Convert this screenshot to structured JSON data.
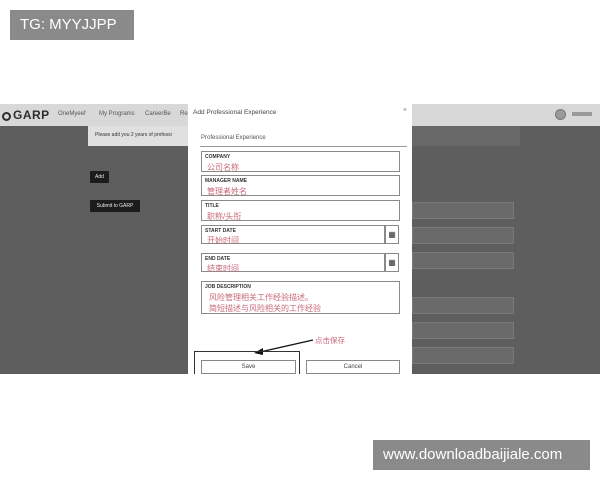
{
  "tag": "TG: MYYJJPP",
  "watermark": "www.downloadbaijiale.com",
  "colors": {
    "annotation": "#c9697a",
    "overlay": "#5e5e5e",
    "tag_bg": "#8a8a8a"
  },
  "app": {
    "logo": "GARP",
    "nav": [
      "OneMyeef",
      "My Programs",
      "CareerBe",
      "Re"
    ],
    "info_text": "Please add you 2 years of professi",
    "add_button": "Add",
    "submit_button": "Submit to GARP"
  },
  "modal": {
    "title": "Add Professional Experience",
    "close": "×",
    "section": "Professional Experience",
    "fields": {
      "company": {
        "label": "COMPANY",
        "value": "公司名称"
      },
      "manager": {
        "label": "MANAGER NAME",
        "value": "管理者姓名"
      },
      "title": {
        "label": "TITLE",
        "value": "职称/头衔"
      },
      "start_date": {
        "label": "START DATE",
        "value": "开始时间"
      },
      "end_date": {
        "label": "END DATE",
        "value": "结束时间"
      },
      "job_description": {
        "label": "JOB DESCRIPTION",
        "lines": [
          "风险管理相关工作经验描述。",
          "简短描述与风险相关的工作经验"
        ]
      }
    },
    "calendar_icon": "calendar-icon",
    "annotation": "点击保存",
    "save_button": "Save",
    "cancel_button": "Cancel"
  }
}
